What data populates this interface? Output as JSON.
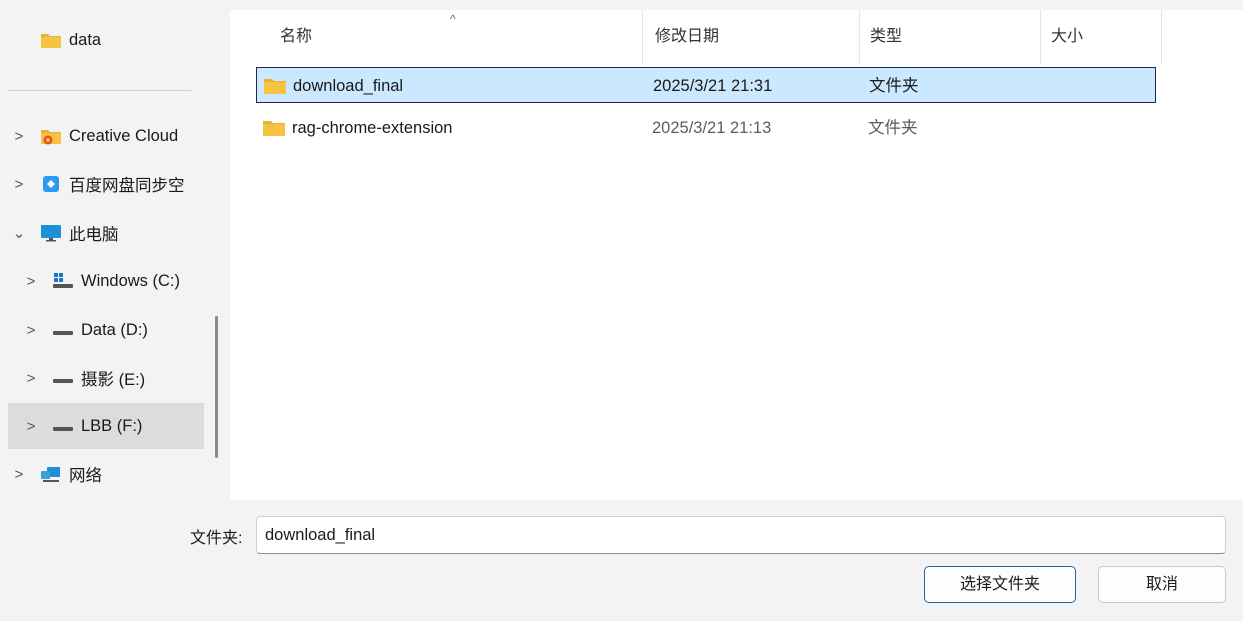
{
  "nav": {
    "items": [
      {
        "label": "data",
        "icon": "folder-icon",
        "chevron": ""
      },
      {
        "label": "Creative Cloud",
        "icon": "creative-cloud-icon",
        "chevron": ">"
      },
      {
        "label": "百度网盘同步空",
        "icon": "baidu-netdisk-icon",
        "chevron": ">"
      },
      {
        "label": "此电脑",
        "icon": "computer-icon",
        "chevron": "⌄"
      },
      {
        "label": "Windows (C:)",
        "icon": "windows-drive-icon",
        "chevron": ">"
      },
      {
        "label": "Data (D:)",
        "icon": "drive-icon",
        "chevron": ">"
      },
      {
        "label": "摄影 (E:)",
        "icon": "drive-icon",
        "chevron": ">"
      },
      {
        "label": "LBB (F:)",
        "icon": "drive-icon",
        "chevron": ">"
      },
      {
        "label": "网络",
        "icon": "network-icon",
        "chevron": ">"
      }
    ]
  },
  "columns": {
    "name": "名称",
    "date": "修改日期",
    "type": "类型",
    "size": "大小",
    "sort_indicator": "^"
  },
  "files": [
    {
      "name": "download_final",
      "date": "2025/3/21 21:31",
      "type": "文件夹",
      "size": ""
    },
    {
      "name": "rag-chrome-extension",
      "date": "2025/3/21 21:13",
      "type": "文件夹",
      "size": ""
    }
  ],
  "footer": {
    "folder_label": "文件夹:",
    "folder_value": "download_final",
    "select_button": "选择文件夹",
    "cancel_button": "取消"
  },
  "colors": {
    "folder": "#f5c242",
    "selection": "#cce8ff",
    "accent": "#2b5d9e"
  }
}
